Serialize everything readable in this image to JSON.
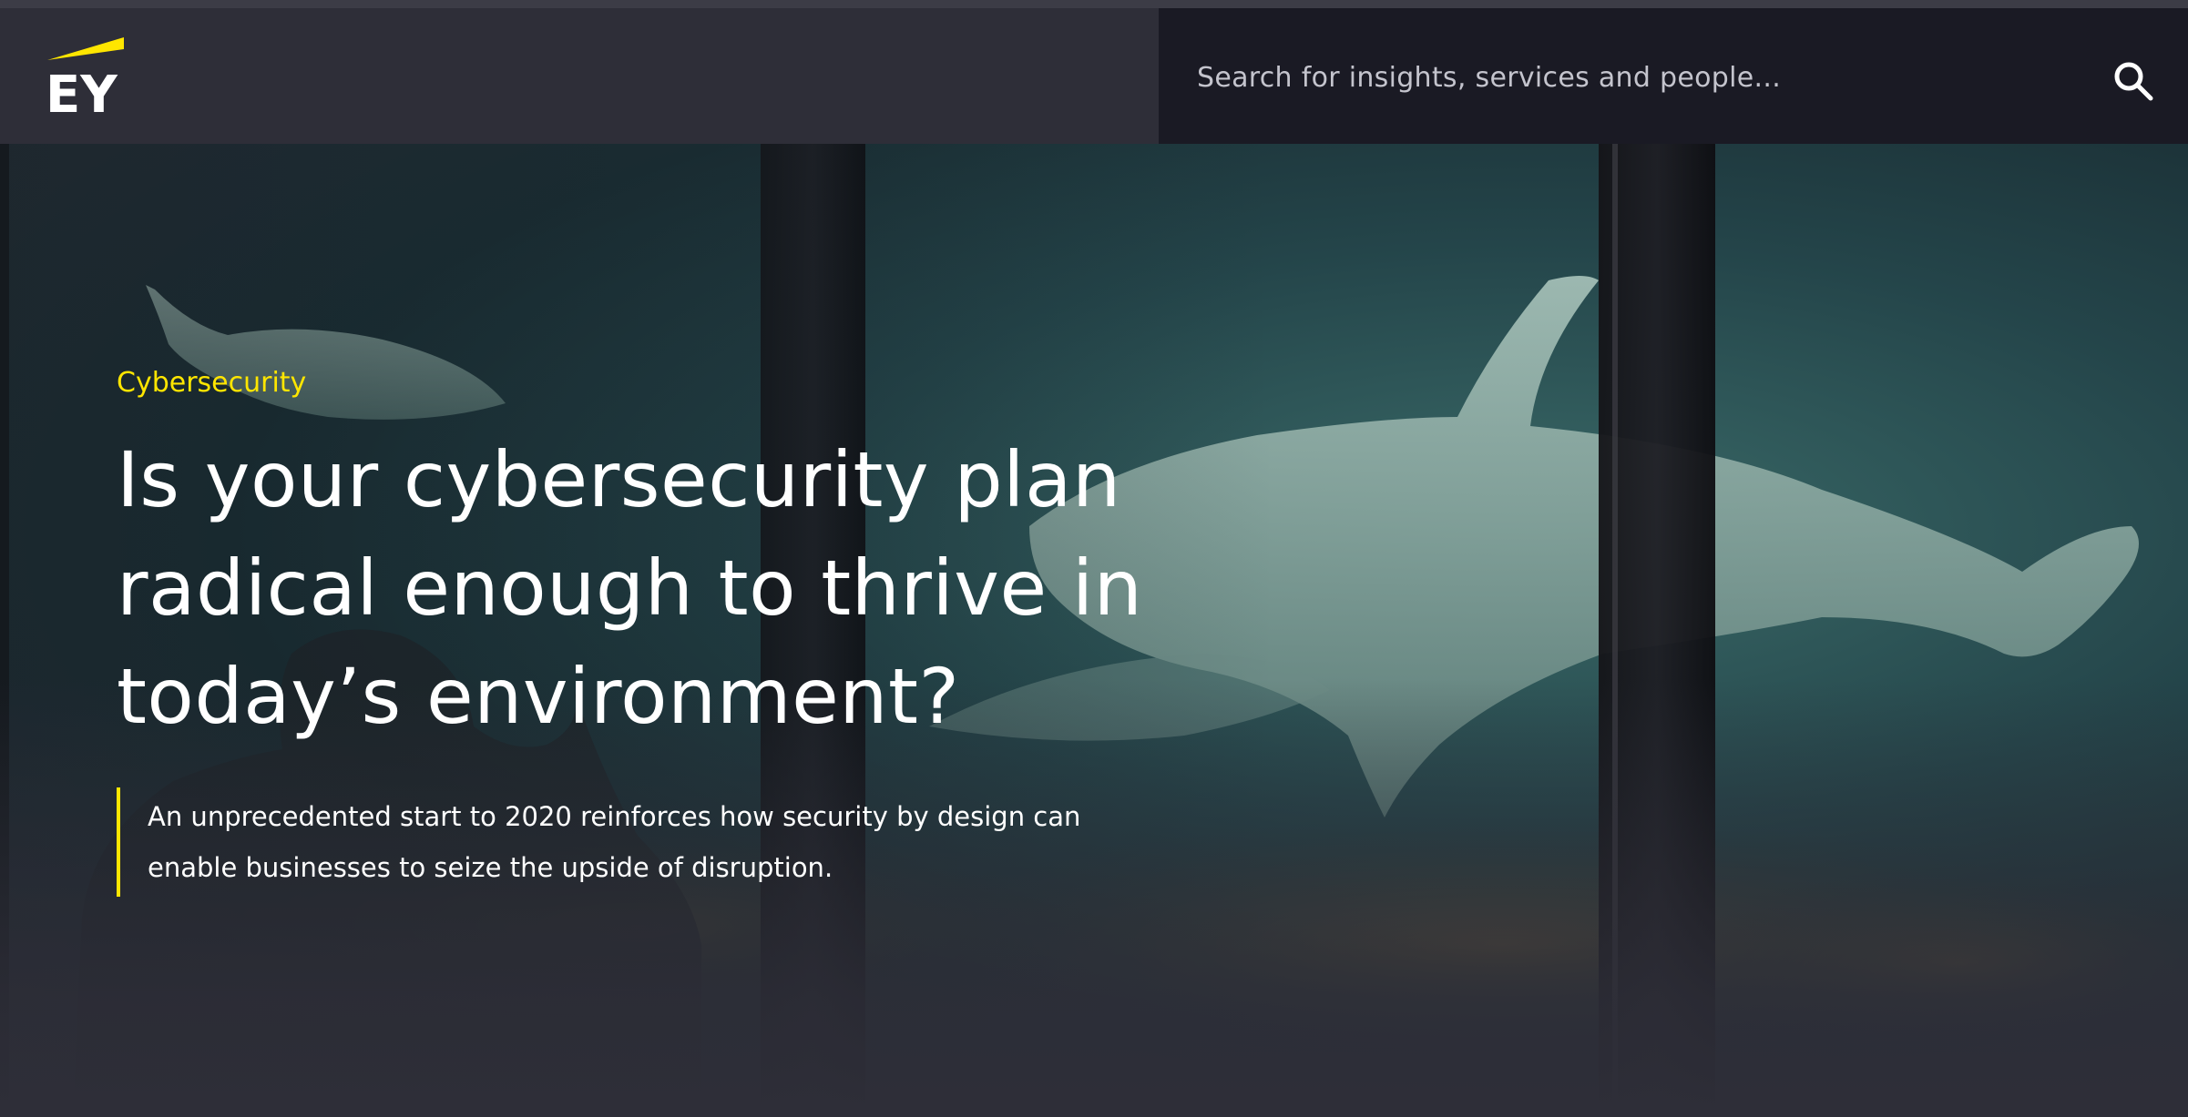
{
  "brand": {
    "logo_text": "EY",
    "accent_color": "#ffe600",
    "header_bg": "#2e2e38",
    "search_bg": "#1a1a24"
  },
  "search": {
    "placeholder": "Search for insights, services and people...",
    "icon": "search-icon"
  },
  "hero": {
    "eyebrow": "Cybersecurity",
    "headline": "Is your cybersecurity plan radical enough to thrive in today’s environment?",
    "summary": "An unprecedented start to 2020 reinforces how security by design can enable businesses to seize the upside of disruption."
  }
}
